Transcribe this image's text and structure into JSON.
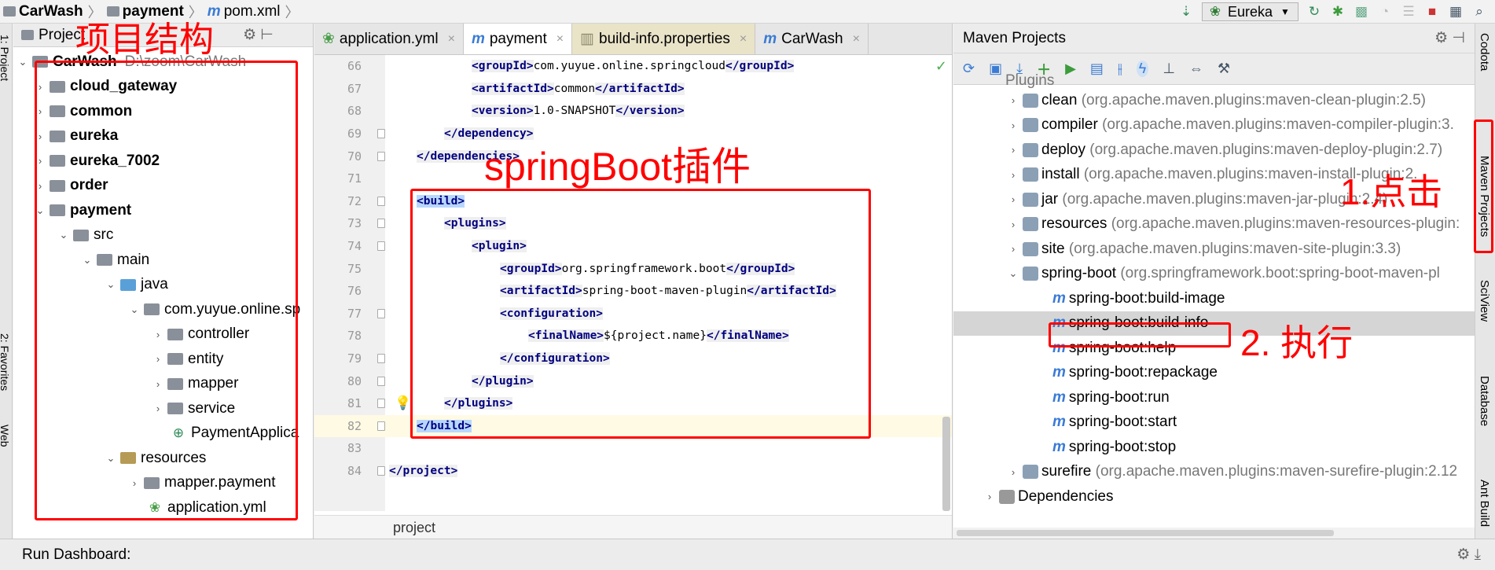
{
  "breadcrumb": {
    "project": "CarWash",
    "module": "payment",
    "file": "pom.xml"
  },
  "run_config": "Eureka",
  "left_strip": {
    "project_tab": "1: Project",
    "favorites_tab": "2: Favorites",
    "web_tab": "Web"
  },
  "right_strip": {
    "codota": "Codota",
    "maven_projects": "Maven Projects",
    "sciview": "SciView",
    "database": "Database",
    "ant_build": "Ant Build"
  },
  "project_panel": {
    "title": "Project",
    "root": {
      "name": "CarWash",
      "path": "D:\\zoom\\CarWash"
    },
    "items": [
      {
        "label": "cloud_gateway"
      },
      {
        "label": "common"
      },
      {
        "label": "eureka"
      },
      {
        "label": "eureka_7002"
      },
      {
        "label": "order"
      },
      {
        "label": "payment"
      },
      {
        "label": "src"
      },
      {
        "label": "main"
      },
      {
        "label": "java"
      },
      {
        "label": "com.yuyue.online.sp"
      },
      {
        "label": "controller"
      },
      {
        "label": "entity"
      },
      {
        "label": "mapper"
      },
      {
        "label": "service"
      },
      {
        "label": "PaymentApplica"
      },
      {
        "label": "resources"
      },
      {
        "label": "mapper.payment"
      },
      {
        "label": "application.yml"
      }
    ]
  },
  "editor": {
    "tabs": [
      {
        "label": "application.yml"
      },
      {
        "label": "payment"
      },
      {
        "label": "build-info.properties"
      },
      {
        "label": "CarWash"
      }
    ],
    "lines": [
      {
        "n": "66",
        "open": "<groupId>",
        "text": "com.yuyue.online.springcloud",
        "close": "</groupId>"
      },
      {
        "n": "67",
        "open": "<artifactId>",
        "text": "common",
        "close": "</artifactId>"
      },
      {
        "n": "68",
        "open": "<version>",
        "text": "1.0-SNAPSHOT",
        "close": "</version>"
      },
      {
        "n": "69",
        "open": "</dependency>",
        "text": "",
        "close": ""
      },
      {
        "n": "70",
        "open": "</dependencies>",
        "text": "",
        "close": ""
      },
      {
        "n": "71",
        "open": "",
        "text": "",
        "close": ""
      },
      {
        "n": "72",
        "open": "<build>",
        "text": "",
        "close": ""
      },
      {
        "n": "73",
        "open": "<plugins>",
        "text": "",
        "close": ""
      },
      {
        "n": "74",
        "open": "<plugin>",
        "text": "",
        "close": ""
      },
      {
        "n": "75",
        "open": "<groupId>",
        "text": "org.springframework.boot",
        "close": "</groupId>"
      },
      {
        "n": "76",
        "open": "<artifactId>",
        "text": "spring-boot-maven-plugin",
        "close": "</artifactId>"
      },
      {
        "n": "77",
        "open": "<configuration>",
        "text": "",
        "close": ""
      },
      {
        "n": "78",
        "open": "<finalName>",
        "text": "${project.name}",
        "close": "</finalName>"
      },
      {
        "n": "79",
        "open": "</configuration>",
        "text": "",
        "close": ""
      },
      {
        "n": "80",
        "open": "</plugin>",
        "text": "",
        "close": ""
      },
      {
        "n": "81",
        "open": "</plugins>",
        "text": "",
        "close": ""
      },
      {
        "n": "82",
        "open": "</build>",
        "text": "",
        "close": ""
      },
      {
        "n": "83",
        "open": "",
        "text": "",
        "close": ""
      },
      {
        "n": "84",
        "open": "</project>",
        "text": "",
        "close": ""
      }
    ],
    "footer_breadcrumb": "project"
  },
  "maven_panel": {
    "title": "Maven Projects",
    "partial_header": "Plugins",
    "plugins": [
      {
        "name": "clean",
        "coord": "(org.apache.maven.plugins:maven-clean-plugin:2.5)"
      },
      {
        "name": "compiler",
        "coord": "(org.apache.maven.plugins:maven-compiler-plugin:3."
      },
      {
        "name": "deploy",
        "coord": "(org.apache.maven.plugins:maven-deploy-plugin:2.7)"
      },
      {
        "name": "install",
        "coord": "(org.apache.maven.plugins:maven-install-plugin:2."
      },
      {
        "name": "jar",
        "coord": "(org.apache.maven.plugins:maven-jar-plugin:2.4)"
      },
      {
        "name": "resources",
        "coord": "(org.apache.maven.plugins:maven-resources-plugin:"
      },
      {
        "name": "site",
        "coord": "(org.apache.maven.plugins:maven-site-plugin:3.3)"
      },
      {
        "name": "spring-boot",
        "coord": "(org.springframework.boot:spring-boot-maven-pl"
      }
    ],
    "goals": [
      {
        "label": "spring-boot:build-image"
      },
      {
        "label": "spring-boot:build-info"
      },
      {
        "label": "spring-boot:help"
      },
      {
        "label": "spring-boot:repackage"
      },
      {
        "label": "spring-boot:run"
      },
      {
        "label": "spring-boot:start"
      },
      {
        "label": "spring-boot:stop"
      }
    ],
    "surefire": {
      "name": "surefire",
      "coord": "(org.apache.maven.plugins:maven-surefire-plugin:2.12"
    },
    "dependencies": "Dependencies"
  },
  "bottom_bar": {
    "label": "Run Dashboard:"
  },
  "annotations": {
    "project_structure": "项目结构",
    "spring_boot_plugin": "springBoot插件",
    "step1": "1.点击",
    "step2": "2. 执行"
  },
  "colors": {
    "annotation": "#ff0000",
    "tag": "#000080",
    "selection": "#b8d7ff",
    "maven_goal": "#3a7bd5"
  }
}
